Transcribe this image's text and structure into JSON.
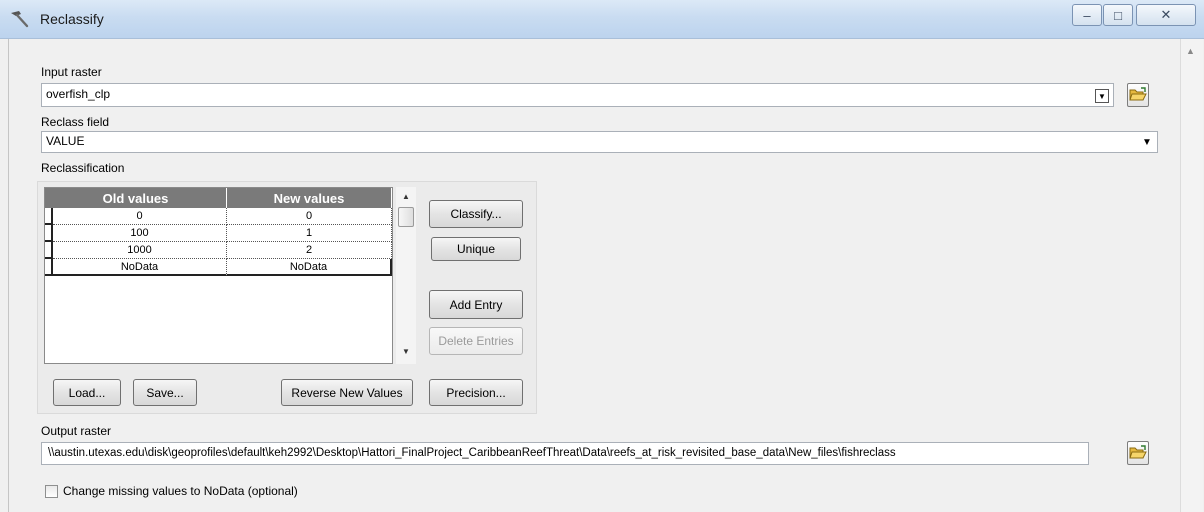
{
  "window": {
    "title": "Reclassify",
    "minimize_glyph": "–",
    "maximize_glyph": "□",
    "close_glyph": "✕"
  },
  "input_raster": {
    "label": "Input raster",
    "value": "overfish_clp"
  },
  "reclass_field": {
    "label": "Reclass field",
    "value": "VALUE"
  },
  "reclassification": {
    "label": "Reclassification",
    "columns": [
      "Old values",
      "New values"
    ],
    "rows": [
      {
        "old": "0",
        "new": "0"
      },
      {
        "old": "100",
        "new": "1"
      },
      {
        "old": "1000",
        "new": "2"
      },
      {
        "old": "NoData",
        "new": "NoData"
      }
    ],
    "buttons": {
      "classify": "Classify...",
      "unique": "Unique",
      "add_entry": "Add Entry",
      "delete_entries": "Delete Entries",
      "load": "Load...",
      "save": "Save...",
      "reverse": "Reverse New Values",
      "precision": "Precision..."
    }
  },
  "output_raster": {
    "label": "Output raster",
    "value": "\\\\austin.utexas.edu\\disk\\geoprofiles\\default\\keh2992\\Desktop\\Hattori_FinalProject_CaribbeanReefThreat\\Data\\reefs_at_risk_revisited_base_data\\New_files\\fishreclass"
  },
  "missing_values": {
    "label": "Change missing values to NoData (optional)",
    "checked": false
  },
  "icons": {
    "title": "hammer-icon",
    "browse": "open-folder-icon"
  }
}
